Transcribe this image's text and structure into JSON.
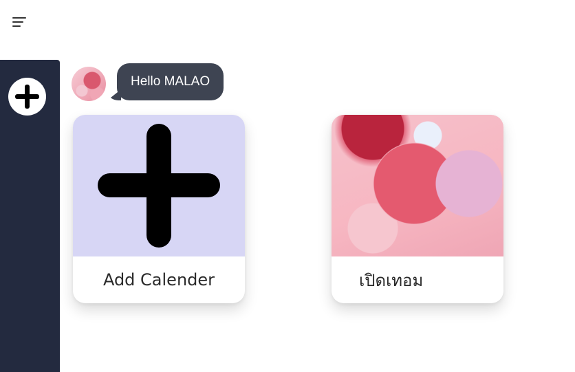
{
  "header": {
    "menu_icon": "hamburger-menu-icon"
  },
  "sidebar": {
    "add_icon": "plus-icon"
  },
  "greeting": {
    "text": "Hello MALAO"
  },
  "cards": [
    {
      "label": "Add Calender",
      "icon": "plus-icon"
    },
    {
      "label": "เปิดเทอม",
      "image": "pink-abstract-spheres"
    }
  ]
}
